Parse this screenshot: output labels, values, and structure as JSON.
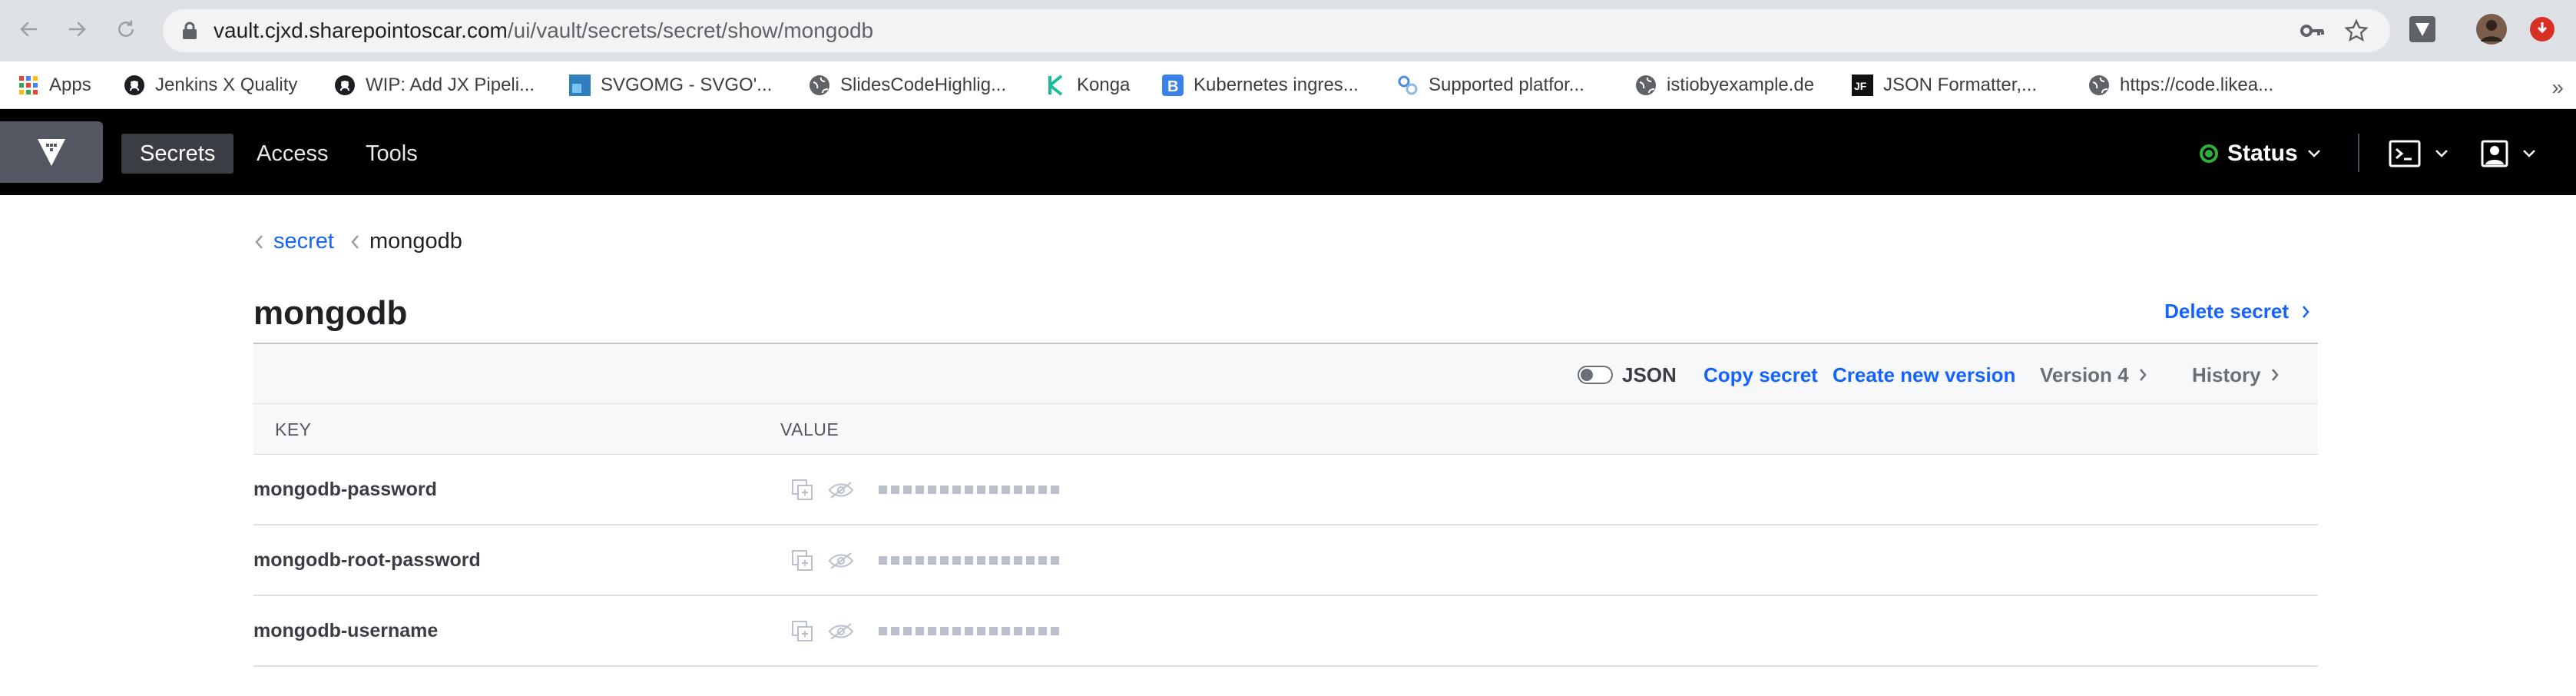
{
  "browser": {
    "url_host": "vault.cjxd.sharepointoscar.com",
    "url_path": "/ui/vault/secrets/secret/show/mongodb",
    "bookmarks": [
      {
        "label": "Apps",
        "icon": "apps-grid-icon"
      },
      {
        "label": "Jenkins X Quality",
        "icon": "github-icon"
      },
      {
        "label": "WIP: Add JX Pipeli...",
        "icon": "github-icon"
      },
      {
        "label": "SVGOMG - SVGO'...",
        "icon": "svgomg-icon"
      },
      {
        "label": "SlidesCodeHighlig...",
        "icon": "globe-icon"
      },
      {
        "label": "Konga",
        "icon": "konga-icon"
      },
      {
        "label": "Kubernetes ingres...",
        "icon": "bookmark-b-icon"
      },
      {
        "label": "Supported platfor...",
        "icon": "link-icon"
      },
      {
        "label": "istiobyexample.de",
        "icon": "globe-icon"
      },
      {
        "label": "JSON Formatter,...",
        "icon": "jf-icon"
      },
      {
        "label": "https://code.likea...",
        "icon": "globe-icon"
      }
    ],
    "bookmarks_more": "»"
  },
  "vault_nav": {
    "links": [
      {
        "label": "Secrets",
        "active": true
      },
      {
        "label": "Access",
        "active": false
      },
      {
        "label": "Tools",
        "active": false
      }
    ],
    "status_label": "Status",
    "status_color": "#2eb039"
  },
  "breadcrumb": {
    "parent": "secret",
    "current": "mongodb"
  },
  "page": {
    "title": "mongodb",
    "delete_label": "Delete secret"
  },
  "toolbar": {
    "json_label": "JSON",
    "copy_label": "Copy secret",
    "create_label": "Create new version",
    "version_label": "Version 4",
    "history_label": "History"
  },
  "table": {
    "key_header": "KEY",
    "value_header": "VALUE",
    "rows": [
      {
        "key": "mongodb-password"
      },
      {
        "key": "mongodb-root-password"
      },
      {
        "key": "mongodb-username"
      }
    ]
  },
  "colors": {
    "accent": "#1563ff",
    "nav_bg": "#000000",
    "logo_bg": "#535862"
  }
}
